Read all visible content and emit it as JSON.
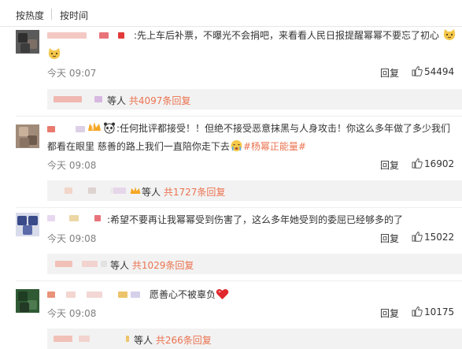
{
  "sort": {
    "by_hot": "按热度",
    "by_time": "按时间"
  },
  "comments": [
    {
      "text": "先上车后补票，不曝光不会捐吧，来看看人民日报提醒幂幂不要忘了初心",
      "time": "今天 09:07",
      "reply": "回复",
      "likes": "54494",
      "sub_prefix": "等人",
      "sub_count": "共4097条回复"
    },
    {
      "text": "任何批评都接受！！但绝不接受恶意抹黑与人身攻击！你这么多年做了多少我们",
      "text2": "都看在眼里 慈善的路上我们一直陪你走下去",
      "tag": "#杨幂正能量#",
      "time": "今天 09:08",
      "reply": "回复",
      "likes": "16902",
      "sub_prefix": "等人",
      "sub_count": "共1727条回复"
    },
    {
      "text": "希望不要再让我幂幂受到伤害了，这么多年她受到的委屈已经够多的了",
      "time": "今天 09:08",
      "reply": "回复",
      "likes": "15022",
      "sub_prefix": "等人",
      "sub_count": "共1029条回复"
    },
    {
      "text": "愿善心不被辜负",
      "time": "今天 09:08",
      "reply": "回复",
      "likes": "10175",
      "sub_prefix": "等人",
      "sub_count": "共266条回复"
    }
  ],
  "colors": {
    "accent": "#eb7350",
    "text": "#333333",
    "muted": "#808080",
    "subbox_bg": "#f2f2f2"
  }
}
